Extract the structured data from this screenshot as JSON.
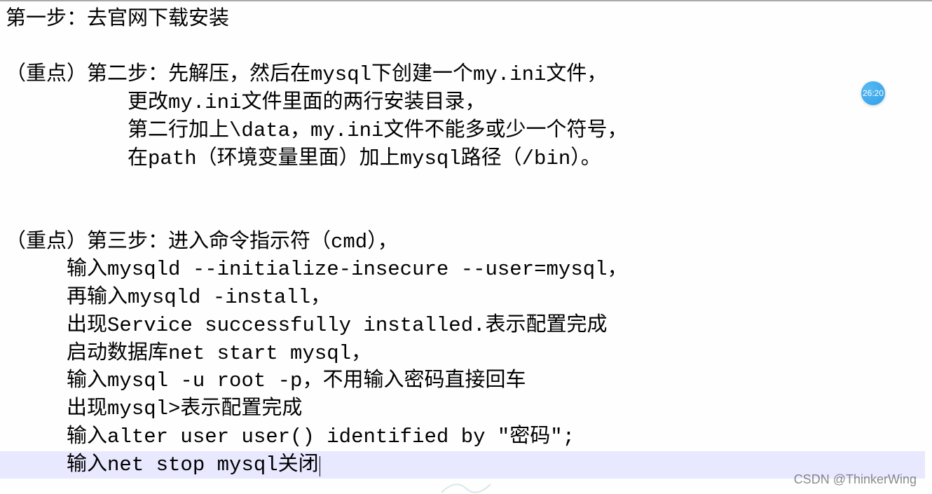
{
  "doc": {
    "step1": "第一步：去官网下载安装",
    "step2_l1": "（重点）第二步：先解压，然后在mysql下创建一个my.ini文件，",
    "step2_l2": "          更改my.ini文件里面的两行安装目录，",
    "step2_l3": "          第二行加上\\data，my.ini文件不能多或少一个符号，",
    "step2_l4": "          在path（环境变量里面）加上mysql路径（/bin）。",
    "step3_l1": "（重点）第三步：进入命令指示符（cmd），",
    "step3_l2": "     输入mysqld --initialize-insecure --user=mysql，",
    "step3_l3": "     再输入mysqld -install，",
    "step3_l4": "     出现Service successfully installed.表示配置完成",
    "step3_l5": "     启动数据库net start mysql，",
    "step3_l6": "     输入mysql -u root -p，不用输入密码直接回车",
    "step3_l7": "     出现mysql>表示配置完成",
    "step3_l8": "     输入alter user user() identified by \"密码\";",
    "step3_l9": "     输入net stop mysql关闭"
  },
  "badge": "26:20",
  "watermark": "CSDN @ThinkerWing"
}
